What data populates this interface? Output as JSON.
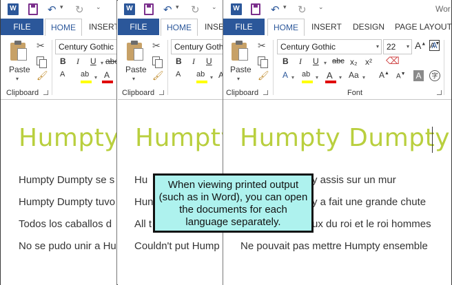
{
  "qat": {
    "app_title_partial": "Wor"
  },
  "tabs": {
    "file": "FILE",
    "home": "HOME",
    "insert": "INSERT",
    "insert_cut": "INSE",
    "design": "DESIGN",
    "page_layout": "PAGE LAYOUT"
  },
  "ribbon": {
    "paste": "Paste",
    "clipboard": "Clipboard",
    "font_group": "Font",
    "font_name": "Century Gothic",
    "font_name_cut": "Century Gothi",
    "font_size": "22",
    "bold": "B",
    "italic": "I",
    "underline": "U",
    "strike": "abc",
    "subscript": "x₂",
    "superscript": "x²",
    "change_case": "Aa",
    "grow_font": "A",
    "shrink_font": "A"
  },
  "doc1": {
    "heading": "Humpty",
    "lines": [
      "Humpty Dumpty se s",
      "Humpty Dumpty tuvo",
      "Todos los caballos d",
      "No se pudo unir a Hu"
    ]
  },
  "doc2": {
    "heading": "Humpty",
    "lines": [
      "Hu",
      "Hun",
      "All t",
      "Couldn't put Hump"
    ]
  },
  "doc3": {
    "heading": "Humpty Dumpty",
    "lines": [
      "y assis sur un mur",
      "y a fait une grande chute",
      "ux du roi et le roi hommes",
      "Ne pouvait pas mettre Humpty ensemble"
    ]
  },
  "callout": {
    "text": "When viewing printed output (such as in Word), you can open the documents for each language separately."
  },
  "colors": {
    "file_tab": "#2b579a",
    "heading": "#b9cf3e",
    "callout_bg": "#aef2ee"
  }
}
